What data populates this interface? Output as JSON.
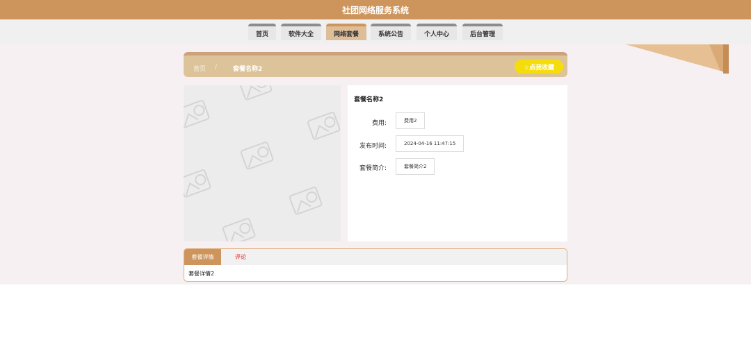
{
  "site": {
    "title": "社团网络服务系统"
  },
  "nav": {
    "items": [
      "首页",
      "软件大全",
      "网络套餐",
      "系统公告",
      "个人中心",
      "后台管理"
    ],
    "active_index": 2
  },
  "breadcrumb": {
    "home": "首页",
    "separator": "/",
    "current": "套餐名称2"
  },
  "favorite": {
    "label": "☆点我收藏"
  },
  "package": {
    "name": "套餐名称2",
    "fields": [
      {
        "label": "费用:",
        "value": "费用2"
      },
      {
        "label": "发布时间:",
        "value": "2024-04-16 11:47:15"
      },
      {
        "label": "套餐简介:",
        "value": "套餐简介2"
      }
    ]
  },
  "tabs": {
    "items": [
      "套餐详情",
      "评论"
    ],
    "active_index": 0,
    "content": "套餐详情2"
  },
  "colors": {
    "brand": "#cd955c",
    "favorite": "#f5dd0c",
    "comment_tab": "#e02020",
    "page_bg": "#f7f0f3"
  },
  "icons": {
    "placeholder": "image-placeholder-icon"
  }
}
